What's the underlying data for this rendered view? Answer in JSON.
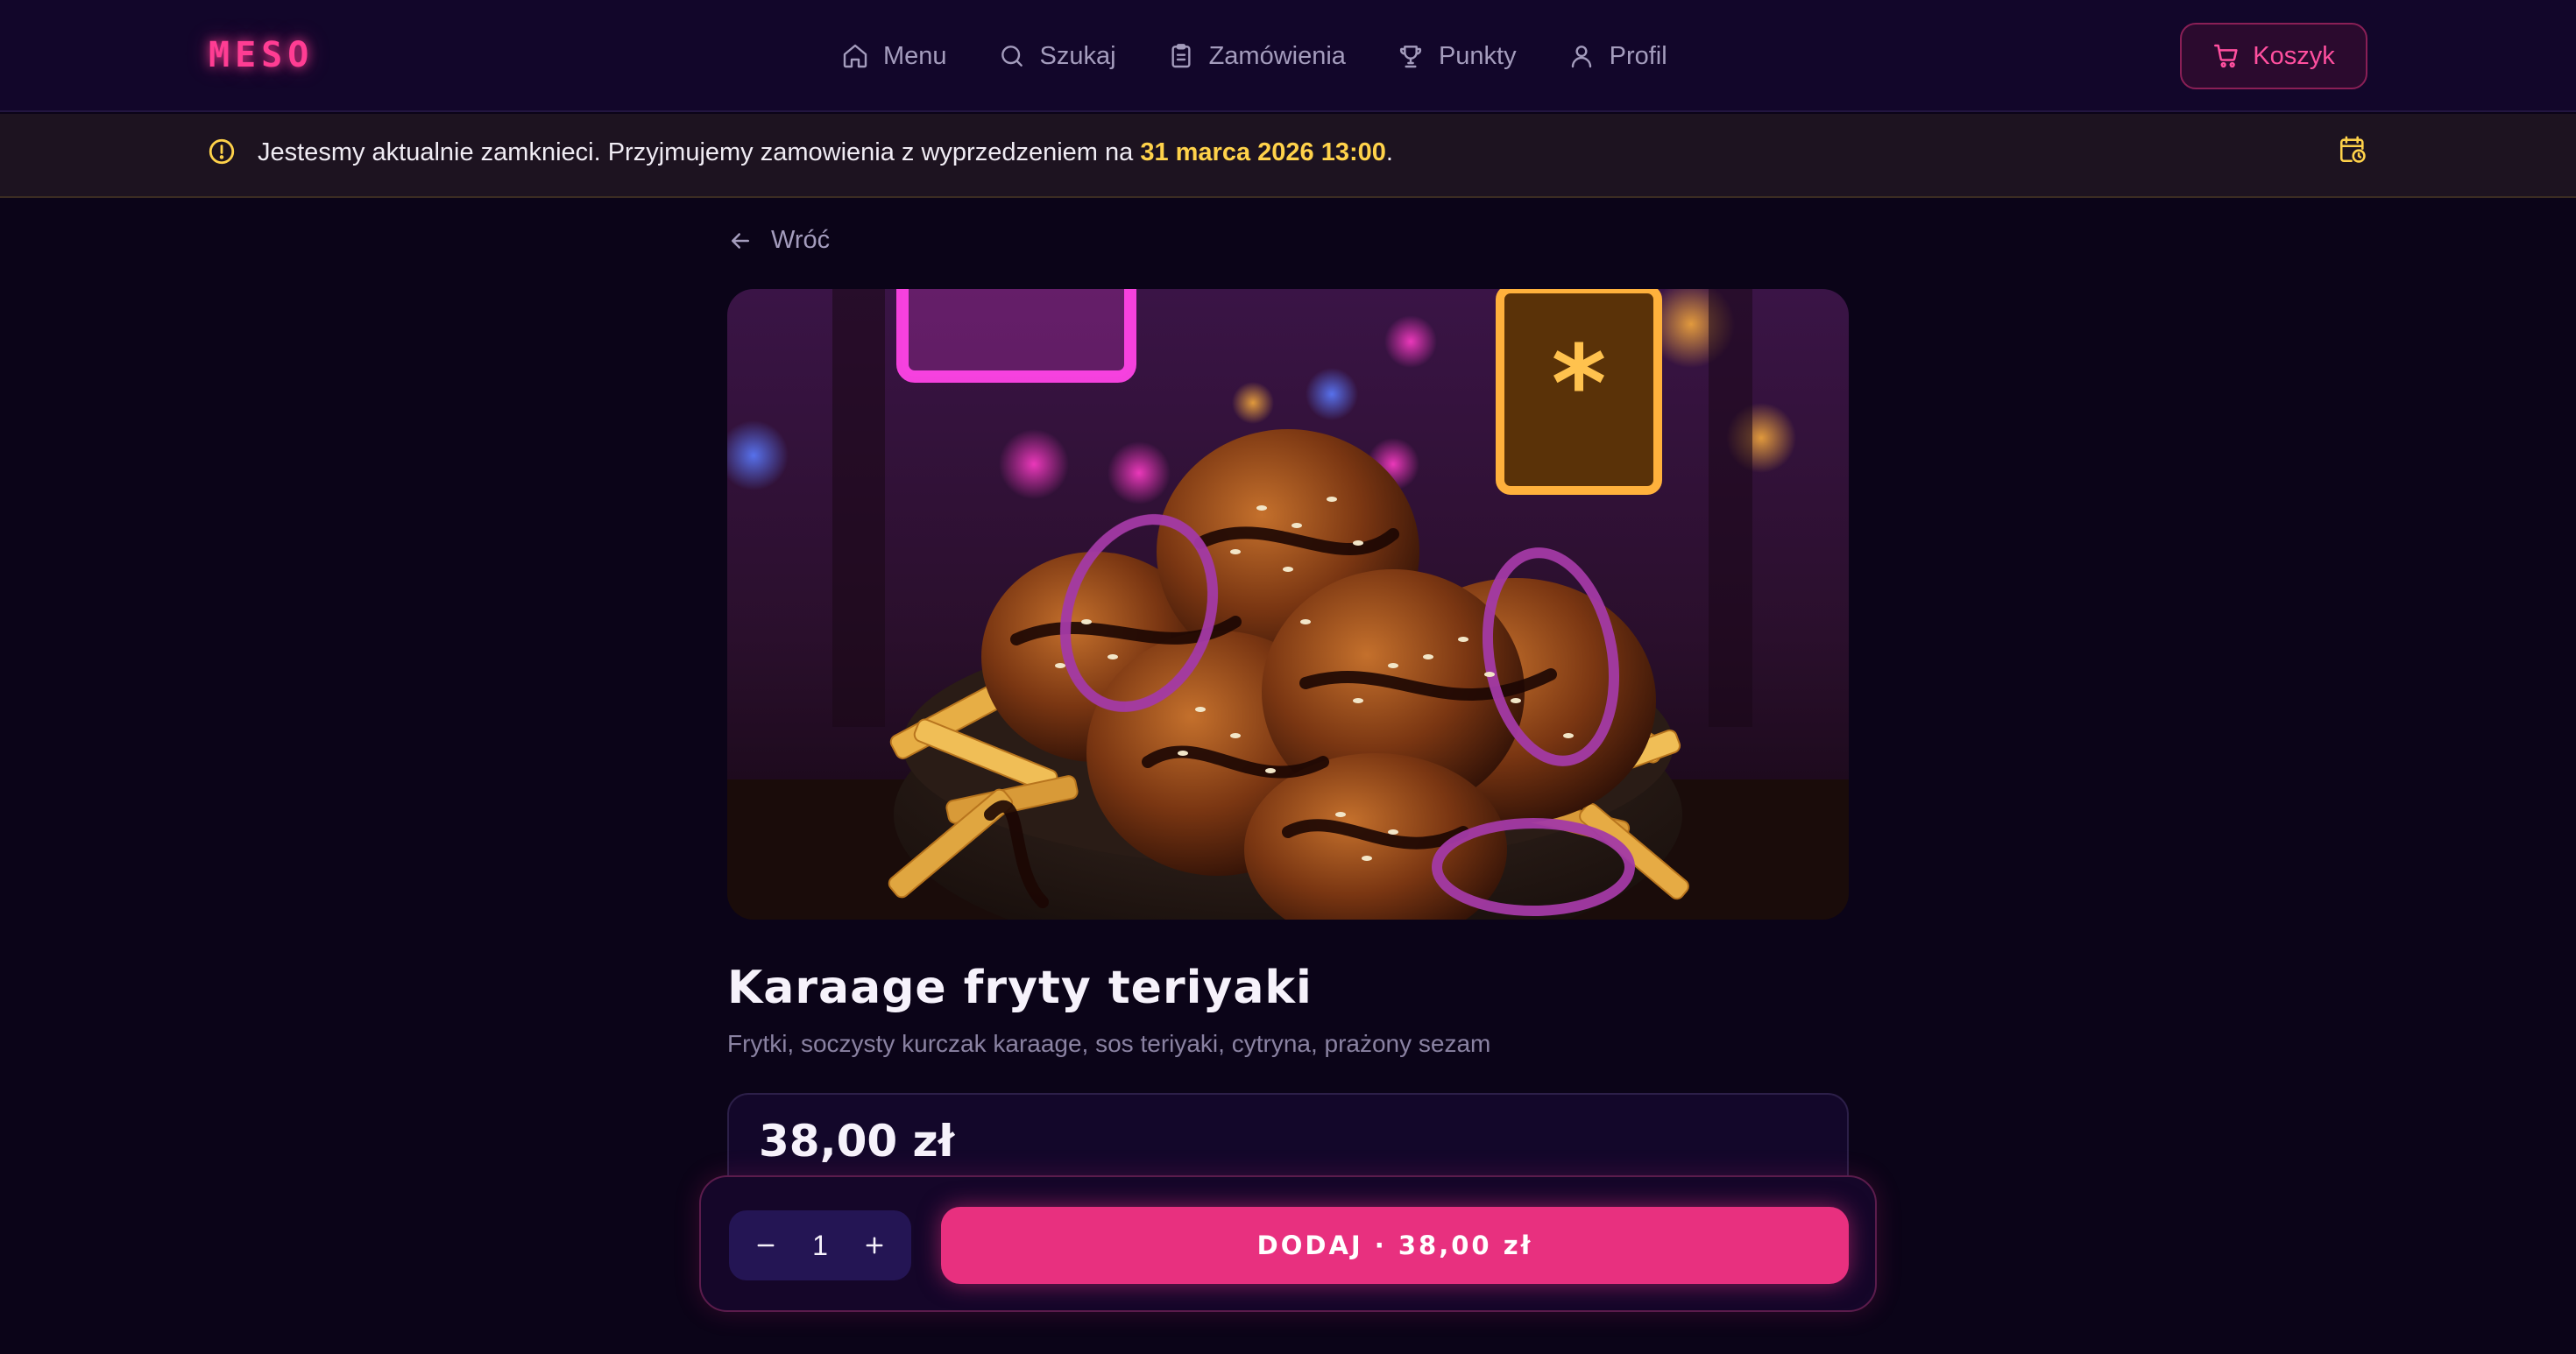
{
  "header": {
    "logo": "MESO",
    "nav": [
      {
        "label": "Menu",
        "icon": "home-icon"
      },
      {
        "label": "Szukaj",
        "icon": "search-icon"
      },
      {
        "label": "Zamówienia",
        "icon": "clipboard-icon"
      },
      {
        "label": "Punkty",
        "icon": "trophy-icon"
      },
      {
        "label": "Profil",
        "icon": "user-icon"
      }
    ],
    "cart_label": "Koszyk"
  },
  "banner": {
    "text": "Jestesmy aktualnie zamknieci. Przyjmujemy zamowienia z wyprzedzeniem na",
    "highlight": "31 marca 2026 13:00",
    "suffix": ".",
    "icon": "alert-circle-icon",
    "action_icon": "calendar-clock-icon"
  },
  "product": {
    "back_label": "Wróć",
    "title": "Karaage fryty teriyaki",
    "description": "Frytki, soczysty kurczak karaage, sos teriyaki, cytryna, prażony sezam",
    "price": "38,00 zł"
  },
  "order": {
    "quantity": "1",
    "add_label": "DODAJ · 38,00 zł"
  },
  "colors": {
    "accent": "#e8307f",
    "background": "#0b0418",
    "highlight": "#ffd24a"
  }
}
